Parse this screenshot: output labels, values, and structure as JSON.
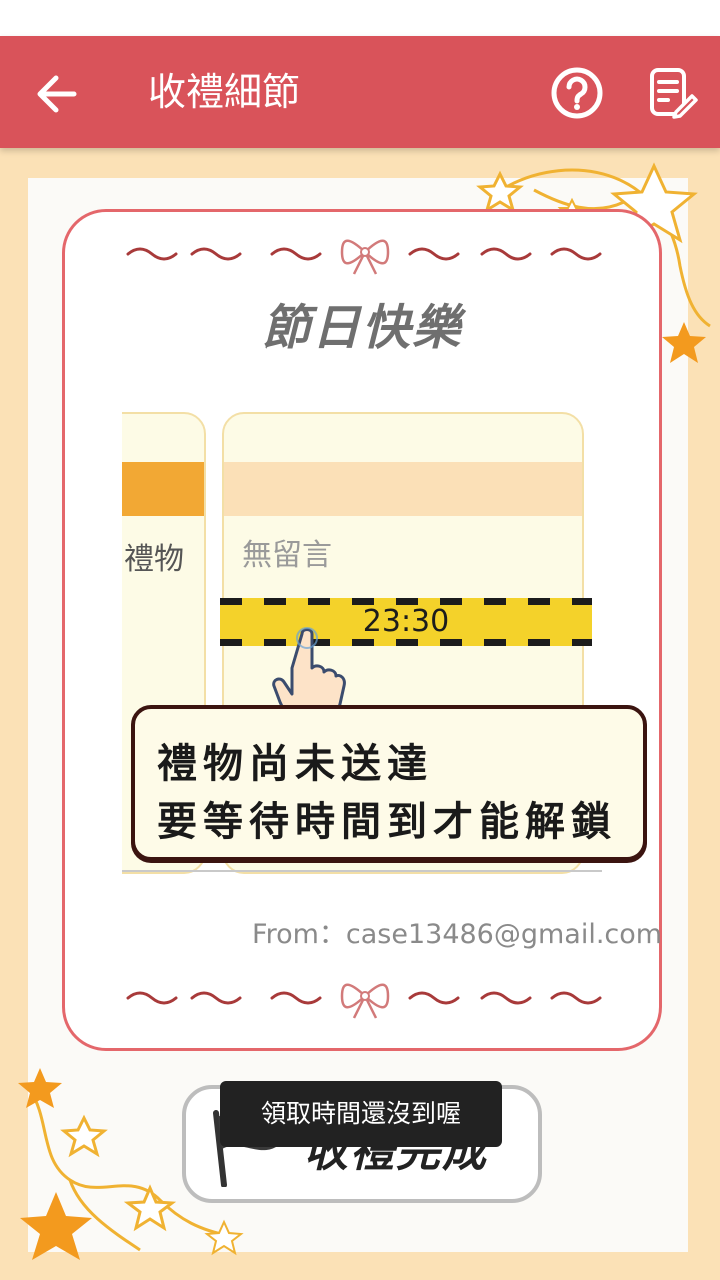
{
  "header": {
    "title": "收禮細節",
    "back_icon": "arrow-left-icon",
    "help_icon": "question-circle-icon",
    "note_icon": "edit-note-icon",
    "bar_color": "#d9535a"
  },
  "card": {
    "title": "節日快樂",
    "from_text": "From：case13486@gmail.com",
    "border_color": "#e4676b"
  },
  "gifts": {
    "prev_label": "禮物",
    "current_message": "無留言",
    "timer": "23:30"
  },
  "warning": {
    "line1": "禮物尚未送達",
    "line2": "要等待時間到才能解鎖"
  },
  "done_button": {
    "label": "收禮完成",
    "icon": "flag-icon"
  },
  "toast": {
    "message": "領取時間還沒到喔"
  },
  "colors": {
    "background": "#fbe1b6",
    "tape": "#f4d22a",
    "accent_orange": "#f2a834"
  }
}
